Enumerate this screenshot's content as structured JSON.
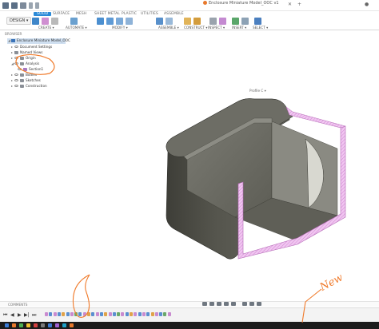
{
  "titlebar": {
    "document_title": "Enclosure Miniature Model_OOC v1"
  },
  "toolbar": {
    "design_label": "DESIGN ▾",
    "tabs": [
      "SOLID",
      "SURFACE",
      "MESH",
      "SHEET METAL",
      "PLASTIC",
      "UTILITIES",
      "ASSEMBLE"
    ],
    "groups": [
      "CREATE ▾",
      "AUTOMATE ▾",
      "MODIFY ▾",
      "ASSEMBLE ▾",
      "CONSTRUCT ▾",
      "INSPECT ▾",
      "INSERT ▾",
      "SELECT ▾"
    ]
  },
  "browser": {
    "header": "BROWSER",
    "items": [
      {
        "label": "Enclosure Miniature Model_OOC"
      },
      {
        "label": "Document Settings"
      },
      {
        "label": "Named Views"
      },
      {
        "label": "Origin"
      },
      {
        "label": "Analysis"
      },
      {
        "label": "Section1"
      },
      {
        "label": "Bodies"
      },
      {
        "label": "Sketches"
      },
      {
        "label": "Construction"
      }
    ]
  },
  "viewport": {
    "analysis_label": "Profile C ▾"
  },
  "comments_panel": {
    "label": "COMMENTS"
  },
  "colors": {
    "accent": "#2a8ad8",
    "body": "#5a5a52",
    "section_hatch": "#e8b3e8",
    "annotation": "#f07a2a"
  },
  "annotations": {
    "handwritten": "New"
  }
}
